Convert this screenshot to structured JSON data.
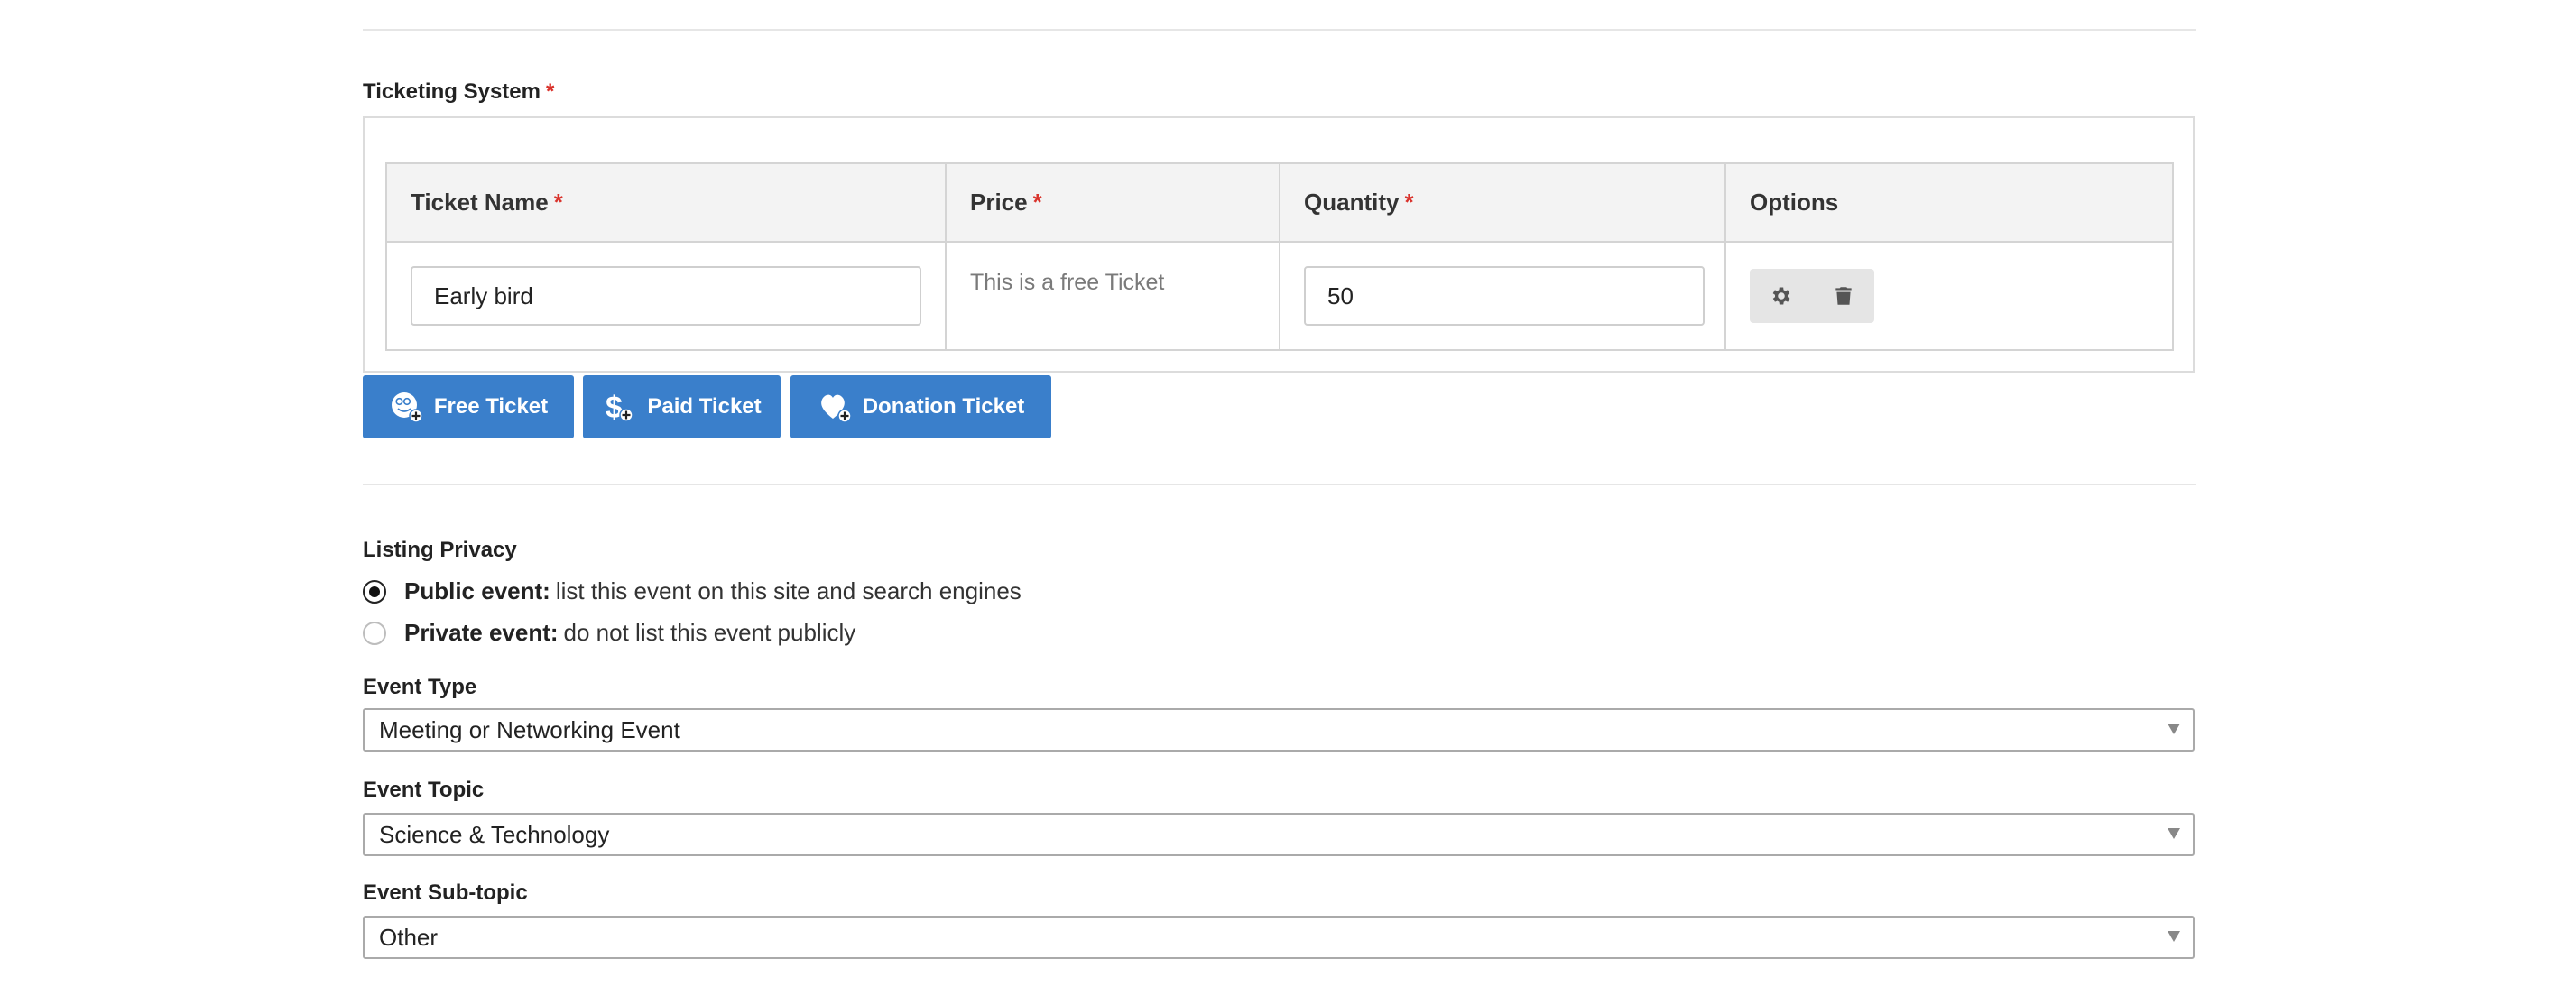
{
  "ticketing": {
    "label": "Ticketing System",
    "required_mark": "*",
    "table": {
      "headers": {
        "ticket_name": "Ticket Name",
        "price": "Price",
        "quantity": "Quantity",
        "options": "Options"
      },
      "rows": [
        {
          "ticket_name": "Early bird",
          "price_text": "This is a free Ticket",
          "quantity": "50"
        }
      ]
    },
    "buttons": {
      "free": "Free Ticket",
      "paid": "Paid Ticket",
      "donation": "Donation Ticket"
    },
    "icons": {
      "settings": "gear-icon",
      "delete": "trash-icon",
      "free": "free-ticket-add-icon",
      "paid": "dollar-add-icon",
      "donation": "heart-add-icon"
    },
    "colors": {
      "button": "#3a7fcb",
      "required": "#d9322b"
    }
  },
  "privacy": {
    "label": "Listing Privacy",
    "options": [
      {
        "bold": "Public event:",
        "text": "list this event on this site and search engines",
        "checked": true
      },
      {
        "bold": "Private event:",
        "text": "do not list this event publicly",
        "checked": false
      }
    ]
  },
  "event_type": {
    "label": "Event Type",
    "value": "Meeting or Networking Event"
  },
  "event_topic": {
    "label": "Event Topic",
    "value": "Science & Technology"
  },
  "event_subtopic": {
    "label": "Event Sub-topic",
    "value": "Other"
  }
}
